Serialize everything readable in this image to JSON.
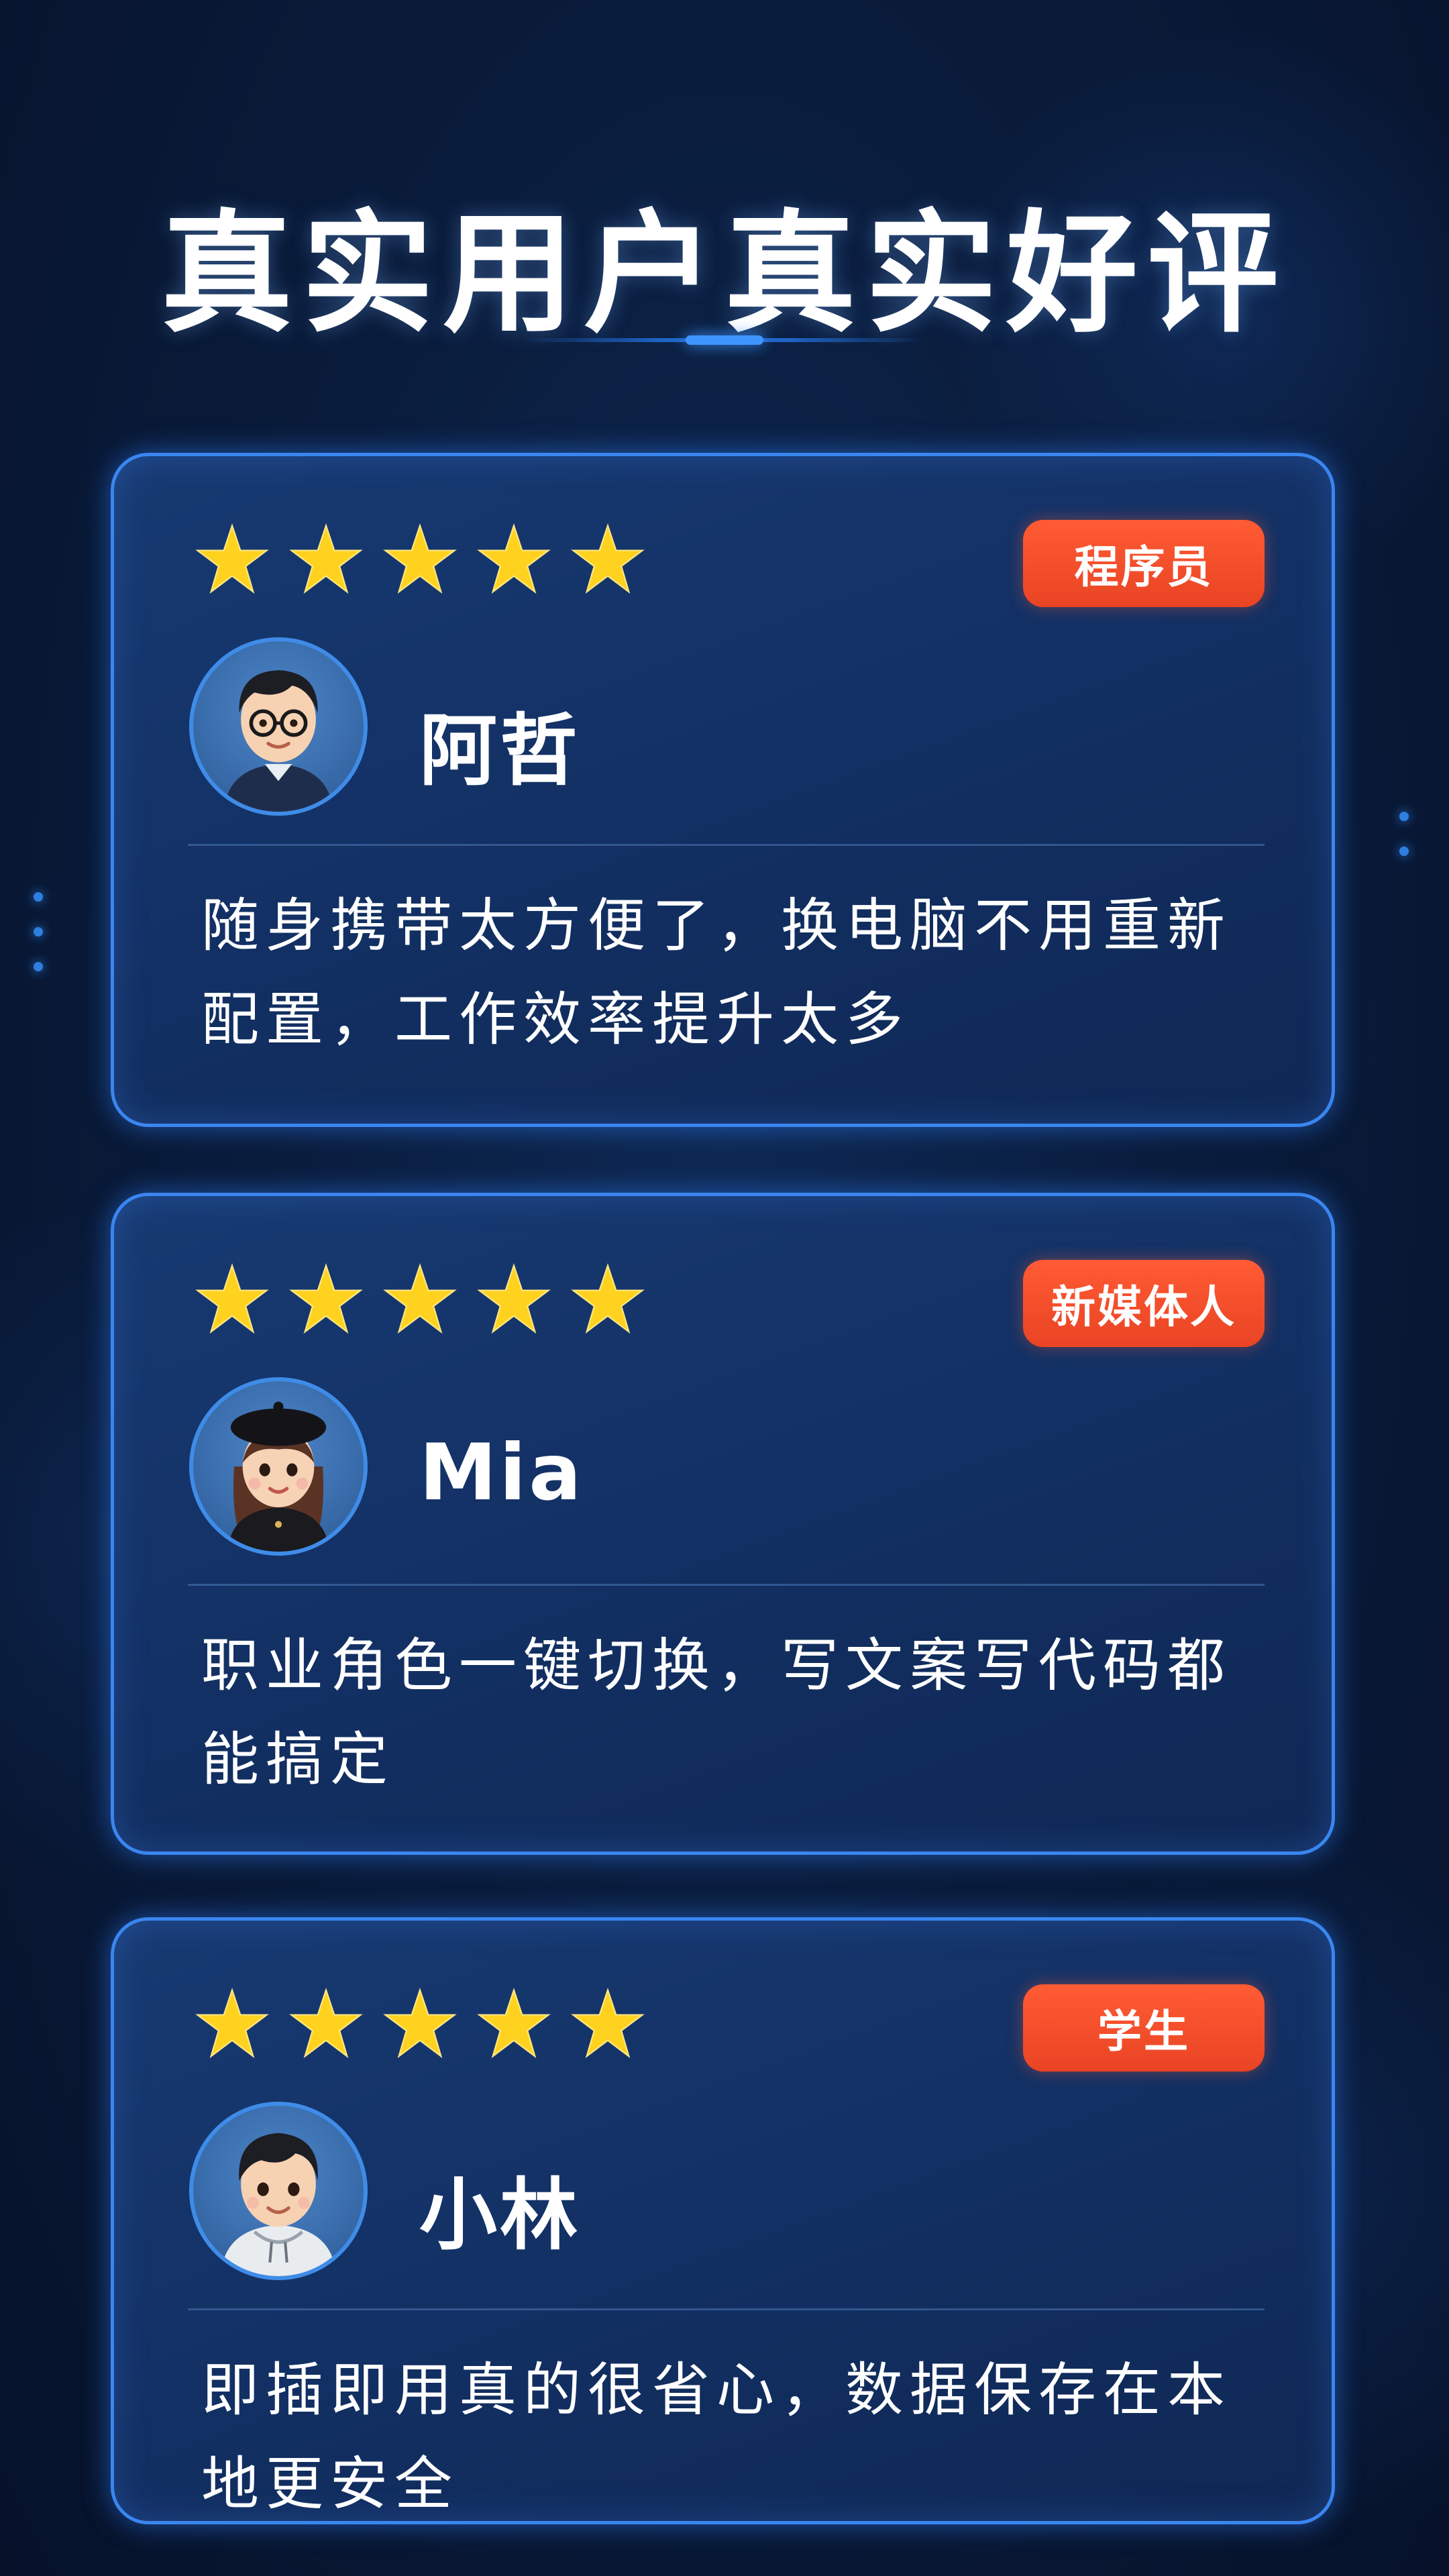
{
  "page": {
    "title": "真实用户真实好评"
  },
  "colors": {
    "background": "#0a1c3c",
    "card_border": "#3a86f0",
    "tag": "#f04c2a",
    "star": "#ffd21f"
  },
  "reviews": [
    {
      "rating": 5,
      "tag": "程序员",
      "name": "阿哲",
      "avatar_icon": "boy-glasses-avatar",
      "text": "随身携带太方便了，换电脑不用重新配置，工作效率提升太多"
    },
    {
      "rating": 5,
      "tag": "新媒体人",
      "name": "Mia",
      "avatar_icon": "girl-beret-avatar",
      "text": "职业角色一键切换，写文案写代码都能搞定"
    },
    {
      "rating": 5,
      "tag": "学生",
      "name": "小林",
      "avatar_icon": "boy-hoodie-avatar",
      "text": "即插即用真的很省心，数据保存在本地更安全"
    }
  ]
}
